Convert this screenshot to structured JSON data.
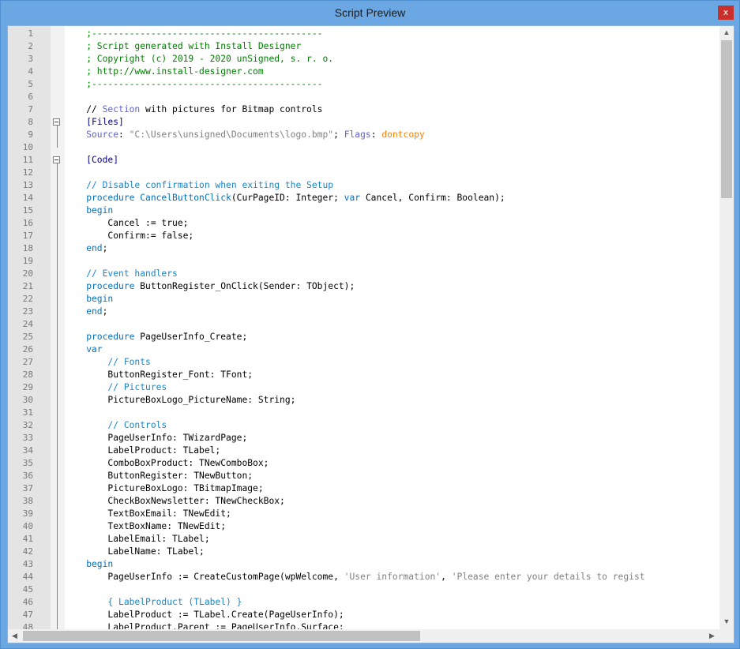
{
  "window": {
    "title": "Script Preview",
    "close_label": "x"
  },
  "editor": {
    "lines": [
      {
        "n": "1",
        "t": [
          {
            "c": "com",
            "s": "    ;-------------------------------------------"
          }
        ]
      },
      {
        "n": "2",
        "t": [
          {
            "c": "com",
            "s": "    ; Script generated with Install Designer"
          }
        ]
      },
      {
        "n": "3",
        "t": [
          {
            "c": "com",
            "s": "    ; Copyright (c) 2019 - 2020 unSigned, s. r. o."
          }
        ]
      },
      {
        "n": "4",
        "t": [
          {
            "c": "com",
            "s": "    ; http://www.install-designer.com"
          }
        ]
      },
      {
        "n": "5",
        "t": [
          {
            "c": "com",
            "s": "    ;-------------------------------------------"
          }
        ]
      },
      {
        "n": "6",
        "t": []
      },
      {
        "n": "7",
        "t": [
          {
            "c": "",
            "s": "    // "
          },
          {
            "c": "key",
            "s": "Section"
          },
          {
            "c": "",
            "s": " with pictures for Bitmap controls"
          }
        ]
      },
      {
        "n": "8",
        "t": [
          {
            "c": "sec",
            "s": "    [Files]"
          }
        ]
      },
      {
        "n": "9",
        "t": [
          {
            "c": "key",
            "s": "    Source"
          },
          {
            "c": "",
            "s": ": "
          },
          {
            "c": "str",
            "s": "\"C:\\Users\\unsigned\\Documents\\logo.bmp\""
          },
          {
            "c": "",
            "s": "; "
          },
          {
            "c": "key",
            "s": "Flags"
          },
          {
            "c": "",
            "s": ": "
          },
          {
            "c": "flag",
            "s": "dontcopy"
          }
        ]
      },
      {
        "n": "10",
        "t": []
      },
      {
        "n": "11",
        "t": [
          {
            "c": "sec",
            "s": "    [Code]"
          }
        ]
      },
      {
        "n": "12",
        "t": []
      },
      {
        "n": "13",
        "t": [
          {
            "c": "cmt",
            "s": "    // Disable confirmation when exiting the Setup"
          }
        ]
      },
      {
        "n": "14",
        "t": [
          {
            "c": "kw",
            "s": "    procedure CancelButtonClick"
          },
          {
            "c": "",
            "s": "(CurPageID: Integer; "
          },
          {
            "c": "kw",
            "s": "var"
          },
          {
            "c": "",
            "s": " Cancel, Confirm: Boolean);"
          }
        ]
      },
      {
        "n": "15",
        "t": [
          {
            "c": "kw",
            "s": "    begin"
          }
        ]
      },
      {
        "n": "16",
        "t": [
          {
            "c": "",
            "s": "        Cancel := true;"
          }
        ]
      },
      {
        "n": "17",
        "t": [
          {
            "c": "",
            "s": "        Confirm:= false;"
          }
        ]
      },
      {
        "n": "18",
        "t": [
          {
            "c": "kw",
            "s": "    end"
          },
          {
            "c": "",
            "s": ";"
          }
        ]
      },
      {
        "n": "19",
        "t": []
      },
      {
        "n": "20",
        "t": [
          {
            "c": "cmt",
            "s": "    // Event handlers"
          }
        ]
      },
      {
        "n": "21",
        "t": [
          {
            "c": "kw",
            "s": "    procedure"
          },
          {
            "c": "",
            "s": " ButtonRegister_OnClick(Sender: TObject);"
          }
        ]
      },
      {
        "n": "22",
        "t": [
          {
            "c": "kw",
            "s": "    begin"
          }
        ]
      },
      {
        "n": "23",
        "t": [
          {
            "c": "kw",
            "s": "    end"
          },
          {
            "c": "",
            "s": ";"
          }
        ]
      },
      {
        "n": "24",
        "t": []
      },
      {
        "n": "25",
        "t": [
          {
            "c": "kw",
            "s": "    procedure"
          },
          {
            "c": "",
            "s": " PageUserInfo_Create;"
          }
        ]
      },
      {
        "n": "26",
        "t": [
          {
            "c": "kw",
            "s": "    var"
          }
        ]
      },
      {
        "n": "27",
        "t": [
          {
            "c": "cmt",
            "s": "        // Fonts"
          }
        ]
      },
      {
        "n": "28",
        "t": [
          {
            "c": "",
            "s": "        ButtonRegister_Font: TFont;"
          }
        ]
      },
      {
        "n": "29",
        "t": [
          {
            "c": "cmt",
            "s": "        // Pictures"
          }
        ]
      },
      {
        "n": "30",
        "t": [
          {
            "c": "",
            "s": "        PictureBoxLogo_PictureName: String;"
          }
        ]
      },
      {
        "n": "31",
        "t": []
      },
      {
        "n": "32",
        "t": [
          {
            "c": "cmt",
            "s": "        // Controls"
          }
        ]
      },
      {
        "n": "33",
        "t": [
          {
            "c": "",
            "s": "        PageUserInfo: TWizardPage;"
          }
        ]
      },
      {
        "n": "34",
        "t": [
          {
            "c": "",
            "s": "        LabelProduct: TLabel;"
          }
        ]
      },
      {
        "n": "35",
        "t": [
          {
            "c": "",
            "s": "        ComboBoxProduct: TNewComboBox;"
          }
        ]
      },
      {
        "n": "36",
        "t": [
          {
            "c": "",
            "s": "        ButtonRegister: TNewButton;"
          }
        ]
      },
      {
        "n": "37",
        "t": [
          {
            "c": "",
            "s": "        PictureBoxLogo: TBitmapImage;"
          }
        ]
      },
      {
        "n": "38",
        "t": [
          {
            "c": "",
            "s": "        CheckBoxNewsletter: TNewCheckBox;"
          }
        ]
      },
      {
        "n": "39",
        "t": [
          {
            "c": "",
            "s": "        TextBoxEmail: TNewEdit;"
          }
        ]
      },
      {
        "n": "40",
        "t": [
          {
            "c": "",
            "s": "        TextBoxName: TNewEdit;"
          }
        ]
      },
      {
        "n": "41",
        "t": [
          {
            "c": "",
            "s": "        LabelEmail: TLabel;"
          }
        ]
      },
      {
        "n": "42",
        "t": [
          {
            "c": "",
            "s": "        LabelName: TLabel;"
          }
        ]
      },
      {
        "n": "43",
        "t": [
          {
            "c": "kw",
            "s": "    begin"
          }
        ]
      },
      {
        "n": "44",
        "t": [
          {
            "c": "",
            "s": "        PageUserInfo := CreateCustomPage(wpWelcome, "
          },
          {
            "c": "str",
            "s": "'User information'"
          },
          {
            "c": "",
            "s": ", "
          },
          {
            "c": "str",
            "s": "'Please enter your details to regist"
          }
        ]
      },
      {
        "n": "45",
        "t": []
      },
      {
        "n": "46",
        "t": [
          {
            "c": "cmt",
            "s": "        { LabelProduct (TLabel) }"
          }
        ]
      },
      {
        "n": "47",
        "t": [
          {
            "c": "",
            "s": "        LabelProduct := TLabel.Create(PageUserInfo);"
          }
        ]
      },
      {
        "n": "48",
        "t": [
          {
            "c": "",
            "s": "        LabelProduct.Parent := PageUserInfo.Surface;"
          }
        ]
      }
    ],
    "fold_markers": [
      "8",
      "11"
    ]
  },
  "scrollbars": {
    "up": "▲",
    "down": "▼",
    "left": "◀",
    "right": "▶"
  },
  "colors": {
    "comment_semicolon": "#008000",
    "comment": "#1a86c8",
    "keyword": "#0070c0",
    "section": "#00008b",
    "key": "#6060d0",
    "string": "#808080",
    "flag": "#ff8000"
  }
}
